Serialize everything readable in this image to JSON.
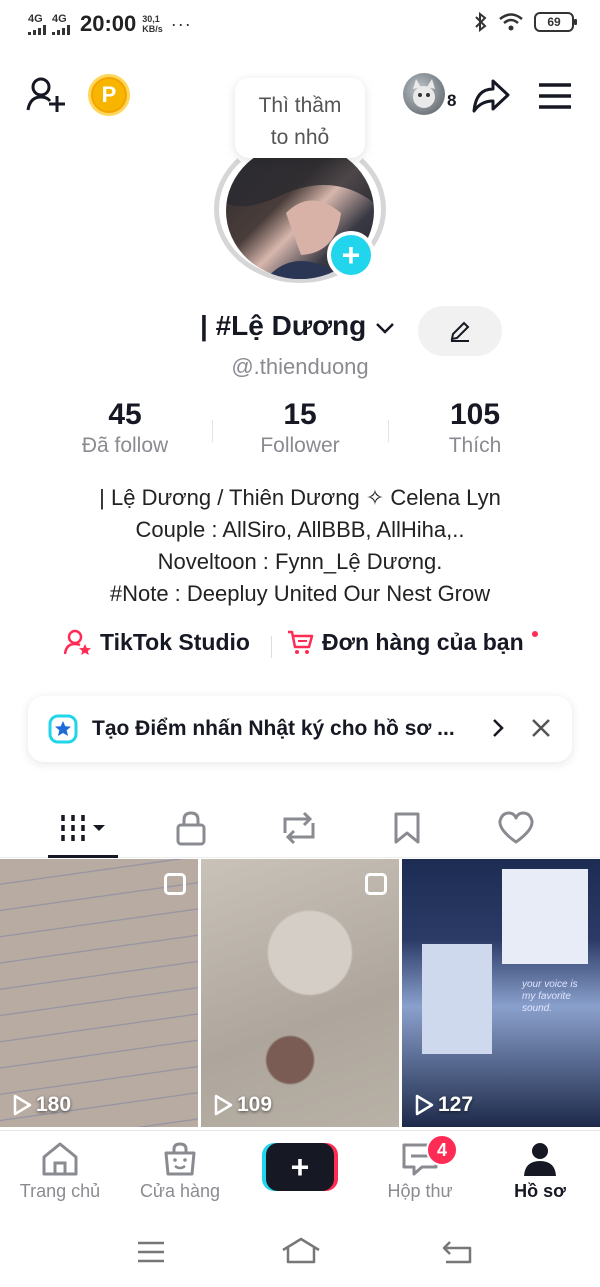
{
  "status_bar": {
    "signal1_label": "4G",
    "signal2_label": "4G",
    "time": "20:00",
    "speed_value": "30,1",
    "speed_unit": "KB/s",
    "dots": "···",
    "battery": "69"
  },
  "avatar": {
    "tooltip_line1": "Thì thầm",
    "tooltip_line2": "to nhỏ",
    "add_symbol": "+"
  },
  "topbar": {
    "coin_letter": "P",
    "friend_count": "8"
  },
  "profile": {
    "display_name": "| #Lệ Dương",
    "handle": "@.thienduong"
  },
  "stats": [
    {
      "value": "45",
      "label": "Đã follow"
    },
    {
      "value": "15",
      "label": "Follower"
    },
    {
      "value": "105",
      "label": "Thích"
    }
  ],
  "bio": [
    "| Lệ Dương / Thiên Dương ✧ Celena Lyn",
    "Couple : AllSiro, AllBBB, AllHiha,..",
    "Noveltoon : Fynn_Lệ Dương.",
    "#Note : Deepluy United Our Nest Grow"
  ],
  "tools": {
    "studio_label": "TikTok Studio",
    "orders_label": "Đơn hàng của bạn"
  },
  "banner": {
    "text": "Tạo Điểm nhấn Nhật ký cho hồ sơ ..."
  },
  "tabs": [
    "videos",
    "private",
    "reposts",
    "favorites",
    "liked"
  ],
  "videos": [
    {
      "views": "180"
    },
    {
      "views": "109"
    },
    {
      "views": "127",
      "overlay_text": "your voice is my favorite sound."
    }
  ],
  "bottom_nav": {
    "home": "Trang chủ",
    "shop": "Cửa hàng",
    "create": "+",
    "inbox": "Hộp thư",
    "inbox_badge": "4",
    "profile": "Hồ sơ"
  },
  "colors": {
    "accent_red": "#fe2c55",
    "accent_cyan": "#20d5ec",
    "text_primary": "#161823",
    "text_secondary": "#8a8b91"
  }
}
